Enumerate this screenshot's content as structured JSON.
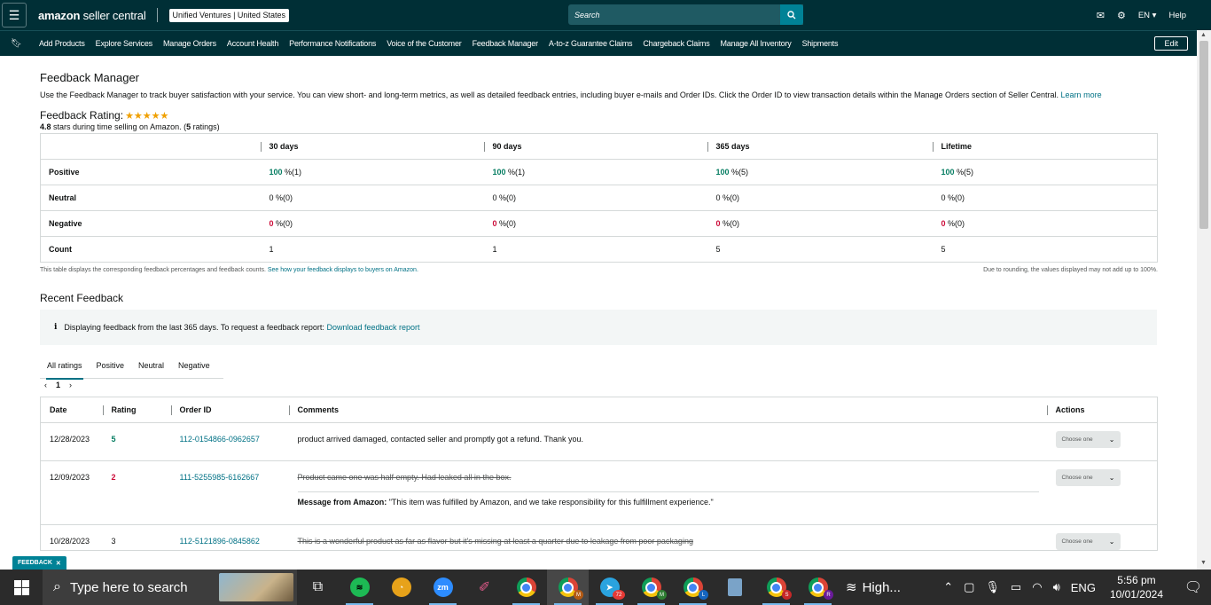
{
  "header": {
    "logo_brand": "amazon",
    "logo_product": "seller central",
    "account_name": "Unified Ventures",
    "account_region": "United States",
    "search_placeholder": "Search",
    "language": "EN",
    "help_label": "Help"
  },
  "nav": {
    "items": [
      "Add Products",
      "Explore Services",
      "Manage Orders",
      "Account Health",
      "Performance Notifications",
      "Voice of the Customer",
      "Feedback Manager",
      "A-to-z Guarantee Claims",
      "Chargeback Claims",
      "Manage All Inventory",
      "Shipments"
    ],
    "edit_label": "Edit"
  },
  "page": {
    "title": "Feedback Manager",
    "description": "Use the Feedback Manager to track buyer satisfaction with your service. You can view short- and long-term metrics, as well as detailed feedback entries, including buyer e-mails and Order IDs. Click the Order ID to view transaction details within the Manage Orders section of Seller Central.",
    "learn_more": "Learn more",
    "rating_label": "Feedback Rating:",
    "rating_value": "4.8",
    "rating_text": " stars during time selling on Amazon. (",
    "rating_count": "5",
    "rating_count_suffix": " ratings)",
    "stars_glyph": "★★★★★"
  },
  "metrics": {
    "columns": [
      "30 days",
      "90 days",
      "365 days",
      "Lifetime"
    ],
    "rows": [
      {
        "label": "Positive",
        "cells": [
          [
            "100",
            " %(1)"
          ],
          [
            "100",
            " %(1)"
          ],
          [
            "100",
            " %(5)"
          ],
          [
            "100",
            " %(5)"
          ]
        ]
      },
      {
        "label": "Neutral",
        "cells": [
          [
            "0",
            " %(0)"
          ],
          [
            "0",
            " %(0)"
          ],
          [
            "0",
            " %(0)"
          ],
          [
            "0",
            " %(0)"
          ]
        ]
      },
      {
        "label": "Negative",
        "cells": [
          [
            "0",
            " %(0)"
          ],
          [
            "0",
            " %(0)"
          ],
          [
            "0",
            " %(0)"
          ],
          [
            "0",
            " %(0)"
          ]
        ]
      },
      {
        "label": "Count",
        "cells": [
          [
            "1",
            ""
          ],
          [
            "1",
            ""
          ],
          [
            "5",
            ""
          ],
          [
            "5",
            ""
          ]
        ]
      }
    ],
    "note_left": "This table displays the corresponding feedback percentages and feedback counts.",
    "note_left_link": "See how your feedback displays to buyers on Amazon.",
    "note_right": "Due to rounding, the values displayed may not add up to 100%."
  },
  "recent": {
    "title": "Recent Feedback",
    "alert_text": "Displaying feedback from the last 365 days. To request a feedback report:",
    "alert_link": "Download feedback report",
    "tabs": [
      "All ratings",
      "Positive",
      "Neutral",
      "Negative"
    ],
    "page_number": "1",
    "columns": [
      "Date",
      "Rating",
      "Order ID",
      "Comments",
      "Actions"
    ],
    "rows": [
      {
        "date": "12/28/2023",
        "rating": "5",
        "order_id": "112-0154866-0962657",
        "comment": "product arrived damaged, contacted seller and promptly got a refund. Thank you."
      },
      {
        "date": "12/09/2023",
        "rating": "2",
        "order_id": "111-5255985-6162667",
        "comment": "Product came one was half empty. Had leaked all in the box.",
        "message_label": "Message from Amazon:",
        "message_text": " \"This item was fulfilled by Amazon, and we take responsibility for this fulfillment experience.\""
      },
      {
        "date": "10/28/2023",
        "rating": "3",
        "order_id": "112-5121896-0845862",
        "comment": "This is a wonderful product as far as flavor but it's missing at least a quarter due to leakage from poor packaging"
      }
    ],
    "action_label": "Choose one"
  },
  "feedback_pill": "FEEDBACK",
  "taskbar": {
    "search_placeholder": "Type here to search",
    "weather": "High...",
    "language": "ENG",
    "time": "5:56 pm",
    "date": "10/01/2024",
    "telegram_badge": "72"
  },
  "colors": {
    "header_bg": "#002f36",
    "accent": "#008296",
    "link": "#007185",
    "positive": "#067d62",
    "negative": "#cc0c39",
    "star": "#f0a000"
  }
}
